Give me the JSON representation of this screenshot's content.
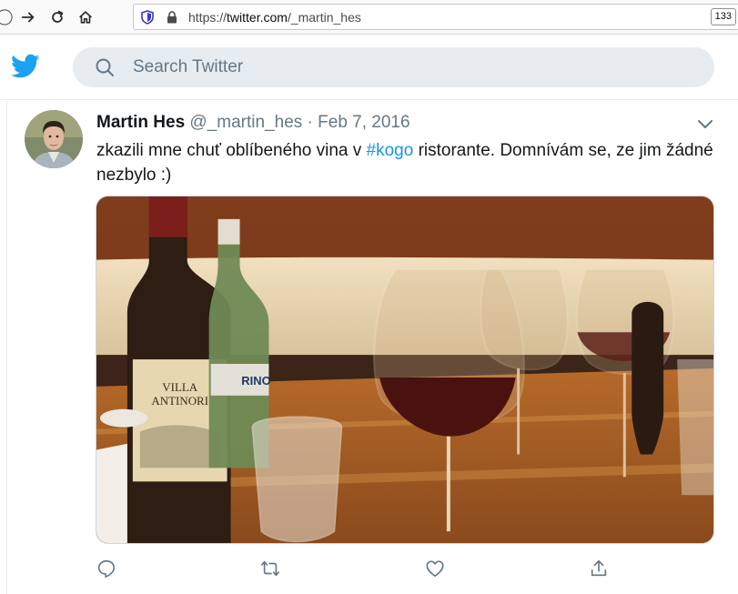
{
  "browser": {
    "url_protocol": "https://",
    "url_host": "twitter.com",
    "url_path": "/_martin_hes",
    "zoom": "133"
  },
  "header": {
    "search_placeholder": "Search Twitter"
  },
  "tweet": {
    "display_name": "Martin Hes",
    "handle": "@_martin_hes",
    "separator": "·",
    "date": "Feb 7, 2016",
    "text_before": "zkazili mne chuť oblíbeného vina v ",
    "hashtag": "#kogo",
    "text_after": " ristorante. Domnívám se, ze jim žádné nezbylo :)",
    "photo_labels": {
      "wine_label": "VILLA ANTINORI",
      "water_label": "RINO"
    }
  },
  "colors": {
    "twitter_blue": "#1da1f2",
    "link": "#1b95e0",
    "secondary_text": "#657786"
  }
}
